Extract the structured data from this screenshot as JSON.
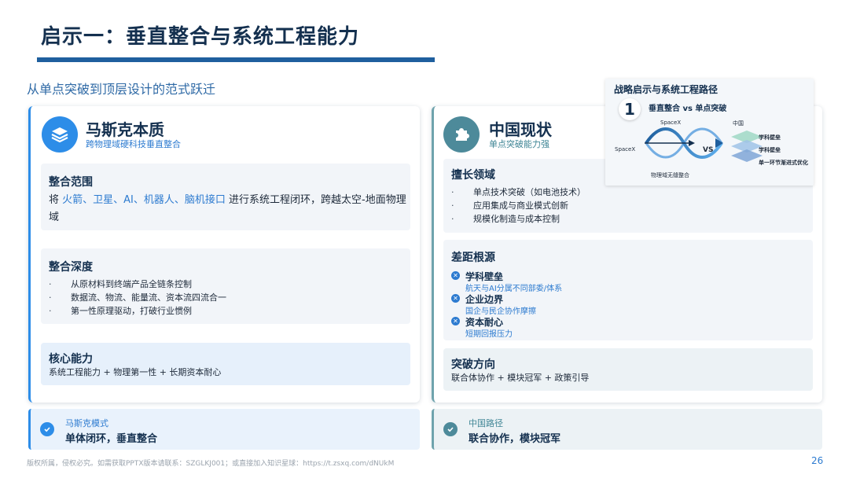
{
  "header": {
    "title": "启示一：垂直整合与系统工程能力",
    "subtitle": "从单点突破到顶层设计的范式跃迁"
  },
  "left": {
    "title": "马斯克本质",
    "subtitle": "跨物理域硬科技垂直整合",
    "scope": {
      "title": "整合范围",
      "prefix": "将",
      "highlight": "火箭、卫星、AI、机器人、脑机接口",
      "suffix": "进行系统工程闭环，跨越太空-地面物理域"
    },
    "depth": {
      "title": "整合深度",
      "items": [
        "从原材料到终端产品全链条控制",
        "数据流、物流、能量流、资本流四流合一",
        "第一性原理驱动，打破行业惯例"
      ]
    },
    "core": {
      "title": "核心能力",
      "text": "系统工程能力 + 物理第一性 + 长期资本耐心"
    },
    "footer": {
      "label": "马斯克模式",
      "value": "单体闭环，垂直整合"
    }
  },
  "right": {
    "title": "中国现状",
    "subtitle": "单点突破能力强",
    "strengths": {
      "title": "擅长领域",
      "items": [
        "单点技术突破（如电池技术）",
        "应用集成与商业模式创新",
        "规模化制造与成本控制"
      ]
    },
    "gaps": {
      "title": "差距根源",
      "items": [
        {
          "title": "学科壁垒",
          "desc": "航天与AI分属不同部委/体系"
        },
        {
          "title": "企业边界",
          "desc": "国企与民企协作摩擦"
        },
        {
          "title": "资本耐心",
          "desc": "短期回报压力"
        }
      ]
    },
    "direction": {
      "title": "突破方向",
      "text": "联合体协作 + 模块冠军 + 政策引导"
    },
    "footer": {
      "label": "中国路径",
      "value": "联合协作，模块冠军"
    }
  },
  "inset": {
    "title": "战略启示与系统工程路径",
    "number": "1",
    "heading": "垂直整合 vs 单点突破",
    "spacex_top": "SpaceX",
    "spacex_left": "SpaceX",
    "vs": "VS",
    "china": "中国",
    "layer1": "学科壁垒",
    "layer2": "学科壁垒",
    "layer3": "单一环节渐进式优化",
    "caption": "物理域无缝整合"
  },
  "footer": {
    "copyright": "版权所属，侵权必究。如需获取PPTX版本请联系：SZGLKJ001；或直接加入知识星球：https://t.zsxq.com/dNUkM",
    "page": "26"
  },
  "colors": {
    "primary": "#1f5f9e",
    "accent_blue": "#2d8de8",
    "accent_teal": "#4d8a9a",
    "dark_text": "#14304f"
  }
}
